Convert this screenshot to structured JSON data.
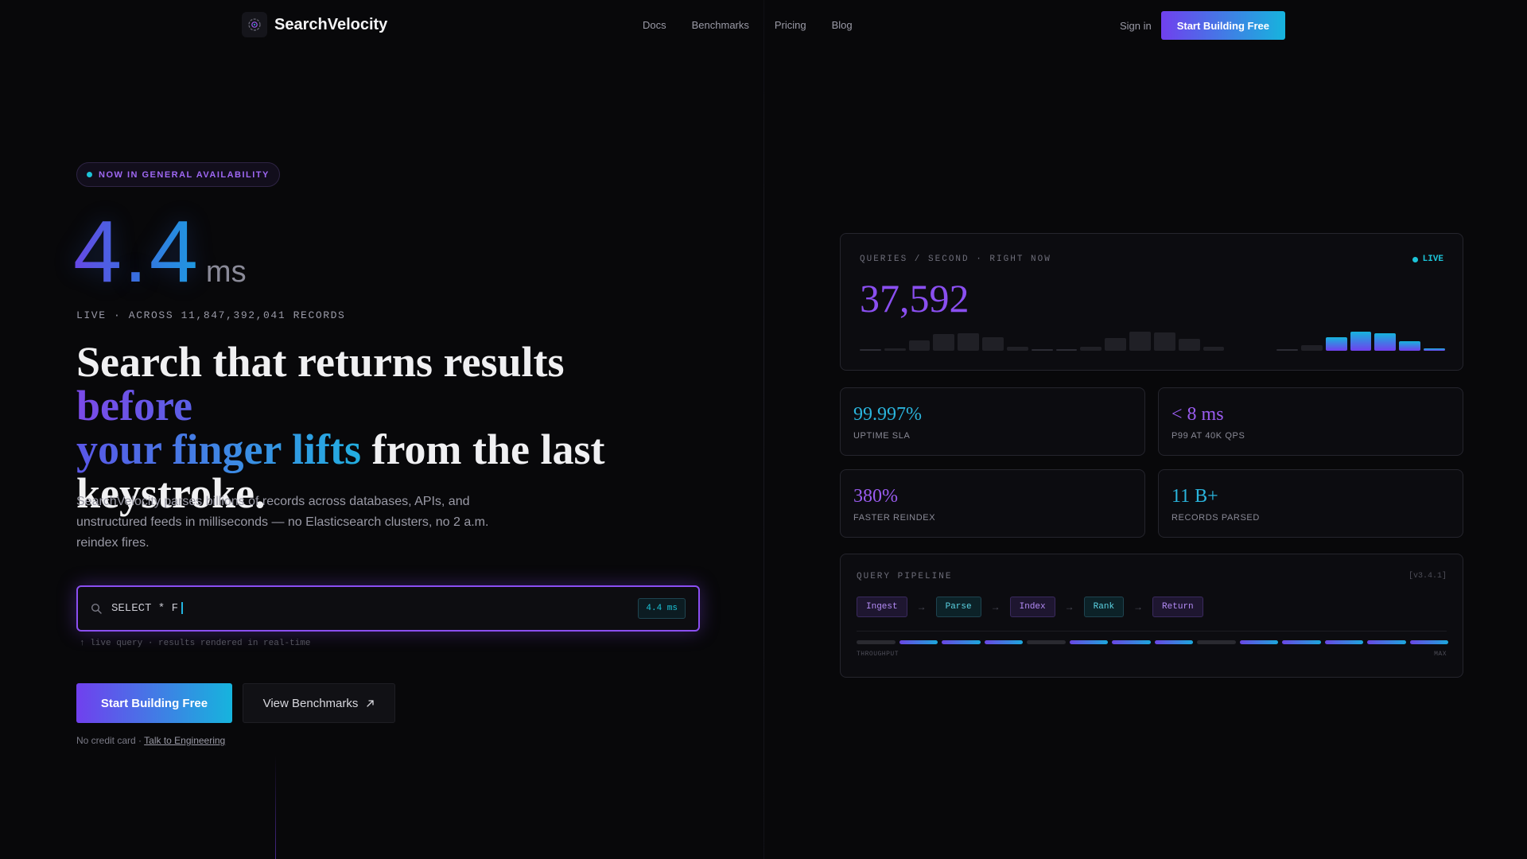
{
  "brand": {
    "name": "SearchVelocity"
  },
  "nav": {
    "links": [
      "Docs",
      "Benchmarks",
      "Pricing",
      "Blog"
    ],
    "sign_in": "Sign in",
    "cta": "Start Building Free"
  },
  "hero": {
    "badge": "NOW IN GENERAL AVAILABILITY",
    "latency_value": "4.4",
    "latency_unit": "ms",
    "live_records": "LIVE · ACROSS 11,847,392,041 RECORDS",
    "headline_part1": "Search that returns results ",
    "headline_grad1": "before",
    "headline_grad2": "your finger lifts",
    "headline_part2": " from the last keystroke.",
    "subcopy": "SearchVelocity parses billions of records across databases, APIs, and unstructured feeds in milliseconds — no Elasticsearch clusters, no 2 a.m. reindex fires.",
    "query_text": "SELECT * F",
    "query_latency": "4.4 ms",
    "query_hint": "↑ live query · results rendered in real-time",
    "cta_primary": "Start Building Free",
    "cta_secondary": "View Benchmarks",
    "no_card": "No credit card · ",
    "talk_link": "Talk to Engineering"
  },
  "qps": {
    "label": "QUERIES / SECOND · RIGHT NOW",
    "live": "LIVE",
    "value": "37,592",
    "bar_levels": [
      0.02,
      0.1,
      0.38,
      0.62,
      0.66,
      0.5,
      0.15,
      0.03,
      0.03,
      0.15,
      0.46,
      0.7,
      0.68,
      0.45,
      0.15,
      0,
      0,
      0.03,
      0.2,
      0.5,
      0.7,
      0.66,
      0.36,
      0.08
    ],
    "bar_highlight_from": 19,
    "colors": {
      "bar": "#202026",
      "highlight_start": "#7040ee",
      "highlight_end": "#16b4dd"
    }
  },
  "stats": [
    {
      "value": "99.997%",
      "label": "UPTIME SLA",
      "color": "#2ab4dc"
    },
    {
      "value": "< 8 ms",
      "label": "P99 AT 40K QPS",
      "color": "#9a5cf0"
    },
    {
      "value": "380%",
      "label": "FASTER REINDEX",
      "color": "#9a5cf0"
    },
    {
      "value": "11 B+",
      "label": "RECORDS PARSED",
      "color": "#2ab4dc"
    }
  ],
  "pipeline": {
    "title": "QUERY PIPELINE",
    "version": "[v3.4.1]",
    "steps": [
      {
        "label": "Ingest",
        "tone": "purple"
      },
      {
        "label": "Parse",
        "tone": "cyan"
      },
      {
        "label": "Index",
        "tone": "purple"
      },
      {
        "label": "Rank",
        "tone": "cyan"
      },
      {
        "label": "Return",
        "tone": "purple"
      }
    ],
    "throughput_on": [
      false,
      true,
      true,
      true,
      false,
      true,
      true,
      true,
      false,
      true,
      true,
      true,
      true,
      true
    ],
    "axis_left": "THROUGHPUT",
    "axis_right": "MAX"
  }
}
